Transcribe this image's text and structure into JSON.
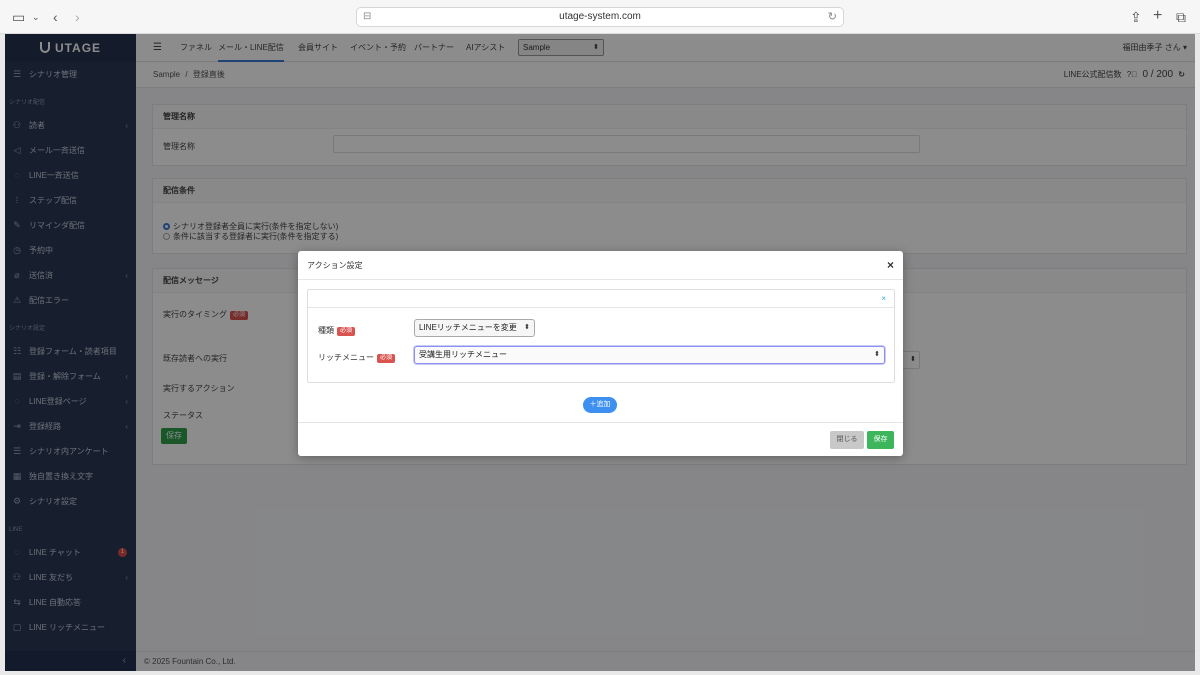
{
  "browser": {
    "url": "utage-system.com",
    "icons": [
      "sidebar-icon",
      "chevron-down-icon",
      "back-icon",
      "forward-icon",
      "share-icon",
      "new-tab-icon",
      "tabs-icon",
      "reload-icon"
    ]
  },
  "sidebar": {
    "logo": "UTAGE",
    "top_item": "シナリオ管理",
    "section1": "シナリオ配信",
    "items1": [
      "読者",
      "メール一斉送信",
      "LINE一斉送信",
      "ステップ配信",
      "リマインダ配信",
      "予約中",
      "送信済",
      "配信エラー"
    ],
    "section2": "シナリオ設定",
    "items2": [
      "登録フォーム・読者項目",
      "登録・解除フォーム",
      "LINE登録ページ",
      "登録経路",
      "シナリオ内アンケート",
      "独自置き換え文字",
      "シナリオ設定"
    ],
    "section3": "LINE",
    "items3": [
      "LINE チャット",
      "LINE 友だち",
      "LINE 自動応答",
      "LINE リッチメニュー"
    ],
    "chat_badge": "1",
    "collapse_icon": "‹"
  },
  "topbar": {
    "tabs": [
      "ファネル",
      "メール・LINE配信",
      "会員サイト",
      "イベント・予約",
      "パートナー",
      "AIアシスト"
    ],
    "active_tab": "メール・LINE配信",
    "account_select": "Sample",
    "user": "福田由季子 さん"
  },
  "breadcrumb": {
    "root": "Sample",
    "sep": "/",
    "current": "登録直後"
  },
  "quota": {
    "label": "LINE公式配信数",
    "value": "0 / 200"
  },
  "cards": {
    "name_header": "管理名称",
    "name_label": "管理名称",
    "condition_header": "配信条件",
    "radio1": "シナリオ登録者全員に実行(条件を指定しない)",
    "radio2": "条件に該当する登録者に実行(条件を指定する)",
    "message_header": "配信メッセージ",
    "timing_label": "実行のタイミング",
    "existing_label": "既存読者への実行",
    "action_label": "実行するアクション",
    "status_label": "ステータス",
    "save_label": "保存",
    "required": "必須"
  },
  "footer": "© 2025 Fountain Co., Ltd.",
  "modal": {
    "title": "アクション設定",
    "close_icon": "×",
    "remove_icon": "×",
    "type_label": "種類",
    "type_value": "LINEリッチメニューを変更",
    "menu_label": "リッチメニュー",
    "menu_value": "受講生用リッチメニュー",
    "required": "必須",
    "add_label": "＋追加",
    "close_label": "閉じる",
    "save_label": "保存"
  }
}
